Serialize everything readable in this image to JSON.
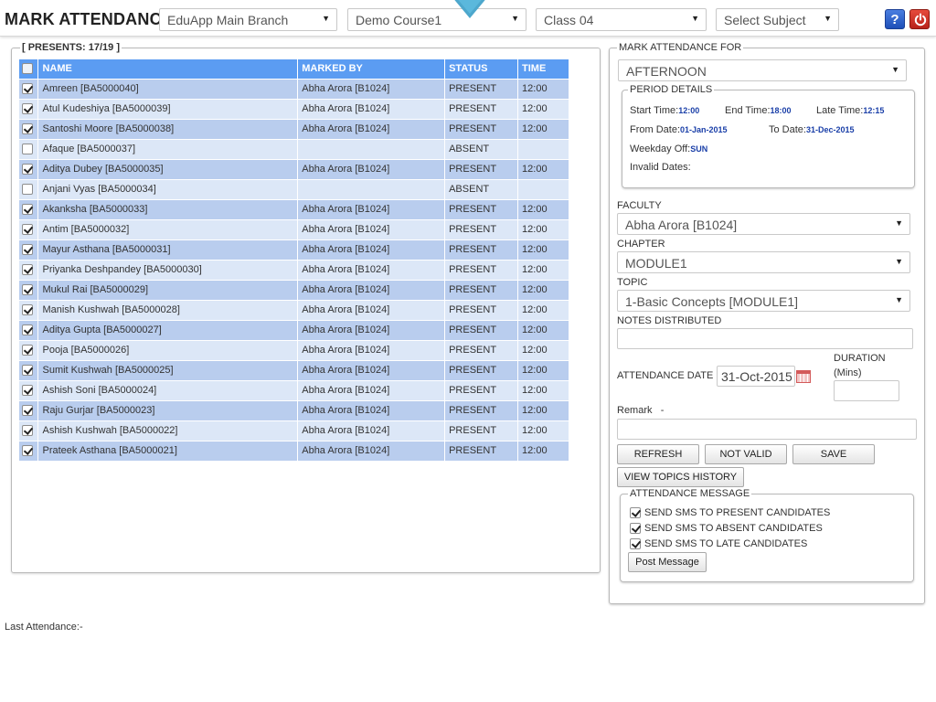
{
  "header": {
    "title": "MARK ATTENDANCE",
    "branch": "EduApp Main Branch",
    "course": "Demo Course1",
    "class": "Class 04",
    "subject": "Select Subject",
    "help_label": "?",
    "colors": {
      "help": "#2a5fd0",
      "power": "#d03424",
      "accent": "#5bb8dc"
    }
  },
  "left": {
    "legend": "[ PRESENTS: 17/19 ]",
    "columns": [
      "NAME",
      "MARKED BY",
      "STATUS",
      "TIME"
    ],
    "rows": [
      {
        "checked": true,
        "name": "Amreen [BA5000040]",
        "marked_by": "Abha Arora [B1024]",
        "status": "PRESENT",
        "time": "12:00"
      },
      {
        "checked": true,
        "name": "Atul Kudeshiya [BA5000039]",
        "marked_by": "Abha Arora [B1024]",
        "status": "PRESENT",
        "time": "12:00"
      },
      {
        "checked": true,
        "name": "Santoshi Moore [BA5000038]",
        "marked_by": "Abha Arora [B1024]",
        "status": "PRESENT",
        "time": "12:00"
      },
      {
        "checked": false,
        "name": "Afaque [BA5000037]",
        "marked_by": "",
        "status": "ABSENT",
        "time": ""
      },
      {
        "checked": true,
        "name": "Aditya Dubey [BA5000035]",
        "marked_by": "Abha Arora [B1024]",
        "status": "PRESENT",
        "time": "12:00"
      },
      {
        "checked": false,
        "name": "Anjani Vyas [BA5000034]",
        "marked_by": "",
        "status": "ABSENT",
        "time": ""
      },
      {
        "checked": true,
        "name": "Akanksha [BA5000033]",
        "marked_by": "Abha Arora [B1024]",
        "status": "PRESENT",
        "time": "12:00"
      },
      {
        "checked": true,
        "name": "Antim [BA5000032]",
        "marked_by": "Abha Arora [B1024]",
        "status": "PRESENT",
        "time": "12:00"
      },
      {
        "checked": true,
        "name": "Mayur Asthana [BA5000031]",
        "marked_by": "Abha Arora [B1024]",
        "status": "PRESENT",
        "time": "12:00"
      },
      {
        "checked": true,
        "name": "Priyanka Deshpandey [BA5000030]",
        "marked_by": "Abha Arora [B1024]",
        "status": "PRESENT",
        "time": "12:00"
      },
      {
        "checked": true,
        "name": "Mukul Rai [BA5000029]",
        "marked_by": "Abha Arora [B1024]",
        "status": "PRESENT",
        "time": "12:00"
      },
      {
        "checked": true,
        "name": "Manish Kushwah [BA5000028]",
        "marked_by": "Abha Arora [B1024]",
        "status": "PRESENT",
        "time": "12:00"
      },
      {
        "checked": true,
        "name": "Aditya Gupta [BA5000027]",
        "marked_by": "Abha Arora [B1024]",
        "status": "PRESENT",
        "time": "12:00"
      },
      {
        "checked": true,
        "name": "Pooja [BA5000026]",
        "marked_by": "Abha Arora [B1024]",
        "status": "PRESENT",
        "time": "12:00"
      },
      {
        "checked": true,
        "name": "Sumit Kushwah [BA5000025]",
        "marked_by": "Abha Arora [B1024]",
        "status": "PRESENT",
        "time": "12:00"
      },
      {
        "checked": true,
        "name": "Ashish Soni [BA5000024]",
        "marked_by": "Abha Arora [B1024]",
        "status": "PRESENT",
        "time": "12:00"
      },
      {
        "checked": true,
        "name": "Raju Gurjar [BA5000023]",
        "marked_by": "Abha Arora [B1024]",
        "status": "PRESENT",
        "time": "12:00"
      },
      {
        "checked": true,
        "name": "Ashish Kushwah [BA5000022]",
        "marked_by": "Abha Arora [B1024]",
        "status": "PRESENT",
        "time": "12:00"
      },
      {
        "checked": true,
        "name": "Prateek Asthana [BA5000021]",
        "marked_by": "Abha Arora [B1024]",
        "status": "PRESENT",
        "time": "12:00"
      }
    ],
    "last_attendance": "Last Attendance:-"
  },
  "right": {
    "legend": "MARK ATTENDANCE FOR",
    "session": "AFTERNOON",
    "period": {
      "legend": "PERIOD DETAILS",
      "start_label": "Start Time:",
      "start_value": "12:00",
      "end_label": "End Time:",
      "end_value": "18:00",
      "late_label": "Late Time:",
      "late_value": "12:15",
      "from_label": "From Date:",
      "from_value": "01-Jan-2015",
      "to_label": "To Date:",
      "to_value": "31-Dec-2015",
      "weekday_label": "Weekday Off:",
      "weekday_value": "SUN",
      "invalid_label": "Invalid Dates:"
    },
    "faculty_label": "FACULTY",
    "faculty": "Abha Arora [B1024]",
    "chapter_label": "CHAPTER",
    "chapter": "MODULE1",
    "topic_label": "TOPIC",
    "topic": "1-Basic Concepts [MODULE1]",
    "notes_label": "NOTES DISTRIBUTED",
    "date_label": "ATTENDANCE DATE",
    "date_value": "31-Oct-2015",
    "duration_label": "DURATION",
    "duration_unit": "(Mins)",
    "remark_label": "Remark",
    "remark_dash": "-",
    "buttons": {
      "refresh": "REFRESH",
      "not_valid": "NOT VALID",
      "save": "SAVE",
      "topics_history": "VIEW TOPICS HISTORY"
    },
    "message": {
      "legend": "ATTENDANCE MESSAGE",
      "sms_present": "SEND SMS TO PRESENT CANDIDATES",
      "sms_absent": "SEND SMS TO ABSENT CANDIDATES",
      "sms_late": "SEND SMS TO LATE CANDIDATES",
      "post": "Post Message"
    }
  }
}
